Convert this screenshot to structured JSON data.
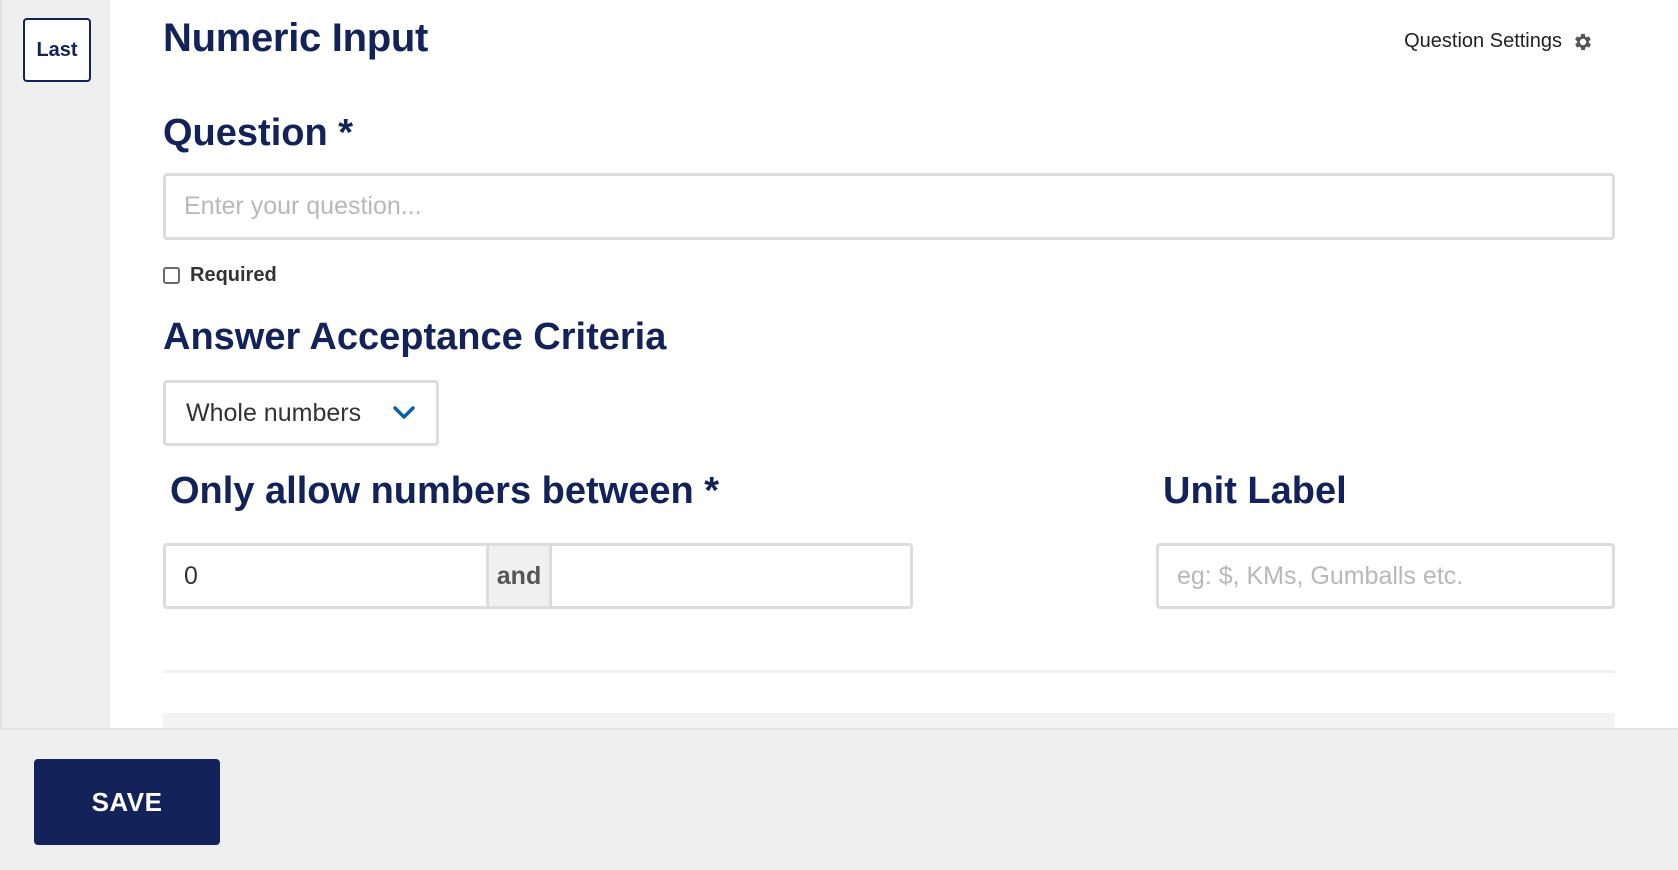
{
  "sidebar": {
    "last_button": "Last"
  },
  "header": {
    "title": "Numeric Input",
    "settings_label": "Question Settings"
  },
  "question": {
    "label": "Question *",
    "placeholder": "Enter your question...",
    "value": "",
    "required_label": "Required",
    "required_checked": false
  },
  "criteria": {
    "label": "Answer Acceptance Criteria",
    "selected": "Whole numbers"
  },
  "range": {
    "label": "Only allow numbers between *",
    "min_value": "0",
    "and_label": "and",
    "max_value": ""
  },
  "unit": {
    "label": "Unit Label",
    "placeholder": "eg: $, KMs, Gumballs etc.",
    "value": ""
  },
  "footer": {
    "save_label": "SAVE"
  },
  "colors": {
    "brand": "#13235a",
    "chevron": "#0e5fa8",
    "sidebar_bg": "#efefef",
    "input_border": "#dcdcdc"
  }
}
